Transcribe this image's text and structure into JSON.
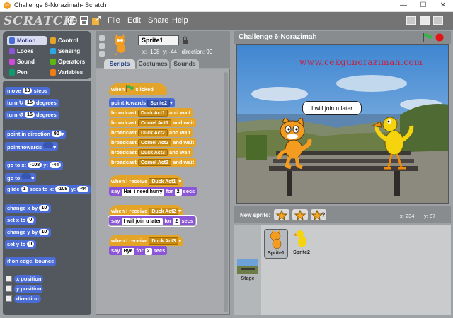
{
  "window": {
    "title": "Challenge 6-Norazimah- Scratch",
    "controls": [
      "minimize-icon",
      "maximize-icon",
      "close-icon"
    ]
  },
  "menubar": {
    "logo": "SCRATCH",
    "menus": [
      "File",
      "Edit",
      "Share",
      "Help"
    ],
    "icons": [
      "globe-icon",
      "save-icon",
      "share-icon"
    ]
  },
  "categories": [
    {
      "label": "Motion",
      "color": "#4a6cd4",
      "selected": true
    },
    {
      "label": "Control",
      "color": "#e4a428"
    },
    {
      "label": "Looks",
      "color": "#8a55d7"
    },
    {
      "label": "Sensing",
      "color": "#2ca5e2"
    },
    {
      "label": "Sound",
      "color": "#cf4ad9"
    },
    {
      "label": "Operators",
      "color": "#5cb712"
    },
    {
      "label": "Pen",
      "color": "#0e9a6c"
    },
    {
      "label": "Variables",
      "color": "#ee7d16"
    }
  ],
  "palette": {
    "move": {
      "pre": "move",
      "val": "10",
      "post": "steps"
    },
    "turn_cw": {
      "pre": "turn",
      "val": "15",
      "post": "degrees"
    },
    "turn_ccw": {
      "pre": "turn",
      "val": "15",
      "post": "degrees"
    },
    "point_dir": {
      "pre": "point in direction",
      "val": "90"
    },
    "point_towards": {
      "pre": "point towards"
    },
    "goto_xy": {
      "pre": "go to x:",
      "x": "-108",
      "ylabel": "y:",
      "y": "-44"
    },
    "goto": {
      "pre": "go to"
    },
    "glide": {
      "pre": "glide",
      "secs": "1",
      "mid": "secs to x:",
      "x": "-108",
      "ylabel": "y:",
      "y": "-44"
    },
    "change_x": {
      "pre": "change x by",
      "val": "10"
    },
    "set_x": {
      "pre": "set x to",
      "val": "0"
    },
    "change_y": {
      "pre": "change y by",
      "val": "10"
    },
    "set_y": {
      "pre": "set y to",
      "val": "0"
    },
    "bounce": "if on edge, bounce",
    "reporters": [
      "x position",
      "y position",
      "direction"
    ]
  },
  "sprite": {
    "name": "Sprite1",
    "x_label": "x:",
    "x": "-108",
    "y_label": "y:",
    "y": "-44",
    "dir_label": "direction:",
    "direction": "90"
  },
  "tabs": [
    "Scripts",
    "Costumes",
    "Sounds"
  ],
  "scripts": {
    "s1": {
      "hat_pre": "when",
      "hat_post": "clicked",
      "point": "point towards",
      "point_target": "Sprite2",
      "broadcast_label": "broadcast",
      "and_wait": "and wait",
      "broadcasts": [
        "Duck Act1",
        "Cornel Act1",
        "Duck Act2",
        "Cornel Act2",
        "Duck Act3",
        "Cornel Act3"
      ]
    },
    "s2": {
      "when": "when I receive",
      "msg": "Duck Act1",
      "say": "say",
      "text": "Hai, i need hurry",
      "for": "for",
      "secs": "2",
      "secs_label": "secs"
    },
    "s3": {
      "when": "when I receive",
      "msg": "Duck Act2",
      "say": "say",
      "text": "I will join u later",
      "for": "for",
      "secs": "2",
      "secs_label": "secs"
    },
    "s4": {
      "when": "when I receive",
      "msg": "Duck Act3",
      "say": "say",
      "text": "Bye",
      "for": "for",
      "secs": "2",
      "secs_label": "secs"
    }
  },
  "stage": {
    "title": "Challenge 6-Norazimah",
    "watermark": "www.cekgunorazimah.com",
    "speech": "I will join u later"
  },
  "new_sprite": {
    "label": "New sprite:"
  },
  "mouse": {
    "x_label": "x:",
    "x": "234",
    "y_label": "y:",
    "y": "87"
  },
  "sprites": [
    {
      "name": "Sprite1",
      "selected": true
    },
    {
      "name": "Sprite2"
    }
  ],
  "stage_thumb_label": "Stage"
}
